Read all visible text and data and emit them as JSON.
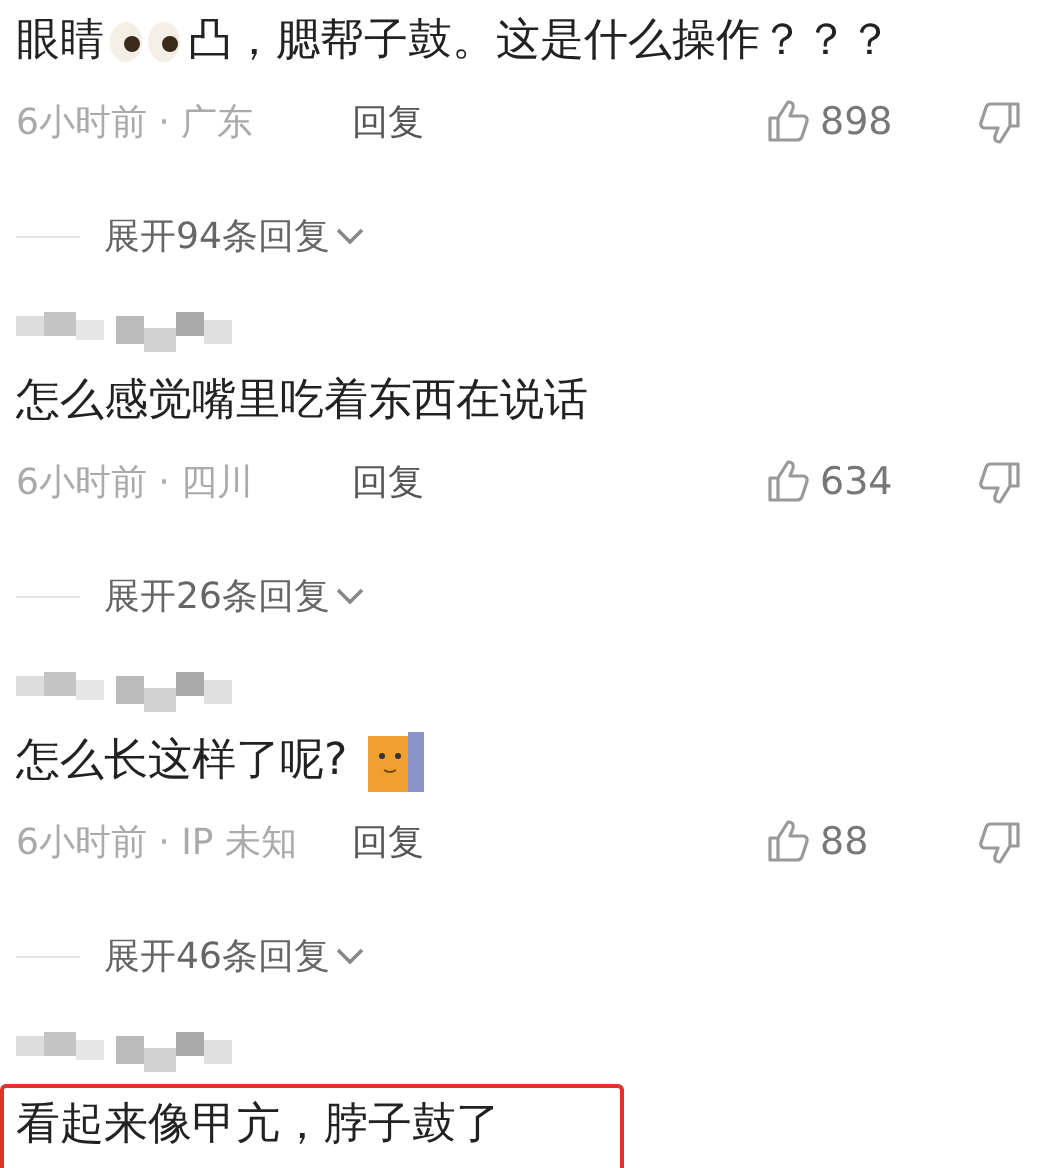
{
  "comments": [
    {
      "author_blurred": false,
      "highlighted": false,
      "parts": [
        {
          "kind": "text",
          "text": "眼睛"
        },
        {
          "kind": "eyes"
        },
        {
          "kind": "text",
          "text": "凸，腮帮子鼓。这是什么操作？？？"
        }
      ],
      "meta": "6小时前 · 广东",
      "reply": "回复",
      "likes": "898",
      "expand": "展开94条回复"
    },
    {
      "author_blurred": true,
      "highlighted": false,
      "parts": [
        {
          "kind": "text",
          "text": "怎么感觉嘴里吃着东西在说话"
        }
      ],
      "meta": "6小时前 · 四川",
      "reply": "回复",
      "likes": "634",
      "expand": "展开26条回复"
    },
    {
      "author_blurred": true,
      "highlighted": false,
      "parts": [
        {
          "kind": "text",
          "text": "怎么长这样了呢?"
        },
        {
          "kind": "cat"
        }
      ],
      "meta": "6小时前 · IP 未知",
      "reply": "回复",
      "likes": "88",
      "expand": "展开46条回复"
    },
    {
      "author_blurred": true,
      "highlighted": true,
      "parts": [
        {
          "kind": "text",
          "text": "看起来像甲亢，脖子鼓了"
        }
      ]
    }
  ]
}
